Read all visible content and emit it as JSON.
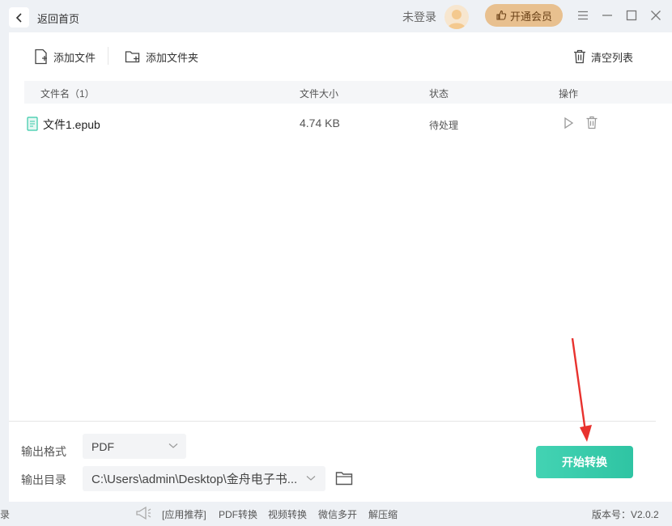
{
  "header": {
    "back_label": "返回首页",
    "login_label": "未登录",
    "vip_label": "开通会员"
  },
  "toolbar": {
    "add_file": "添加文件",
    "add_folder": "添加文件夹",
    "clear_list": "清空列表"
  },
  "table": {
    "columns": [
      "文件名（1）",
      "文件大小",
      "状态",
      "操作"
    ],
    "rows": [
      {
        "name": "文件1.epub",
        "size": "4.74 KB",
        "status": "待处理"
      }
    ]
  },
  "output": {
    "format_label": "输出格式",
    "format_value": "PDF",
    "dir_label": "输出目录",
    "dir_value": "C:\\Users\\admin\\Desktop\\金舟电子书..."
  },
  "start_label": "开始转换",
  "footer": {
    "left_fragment": "录",
    "links": [
      "[应用推荐]",
      "PDF转换",
      "视频转换",
      "微信多开",
      "解压缩"
    ],
    "version": "版本号：V2.0.2"
  },
  "colors": {
    "accent": "#36c9a8",
    "vip": "#e8c08f",
    "arrow": "#e8322e"
  }
}
